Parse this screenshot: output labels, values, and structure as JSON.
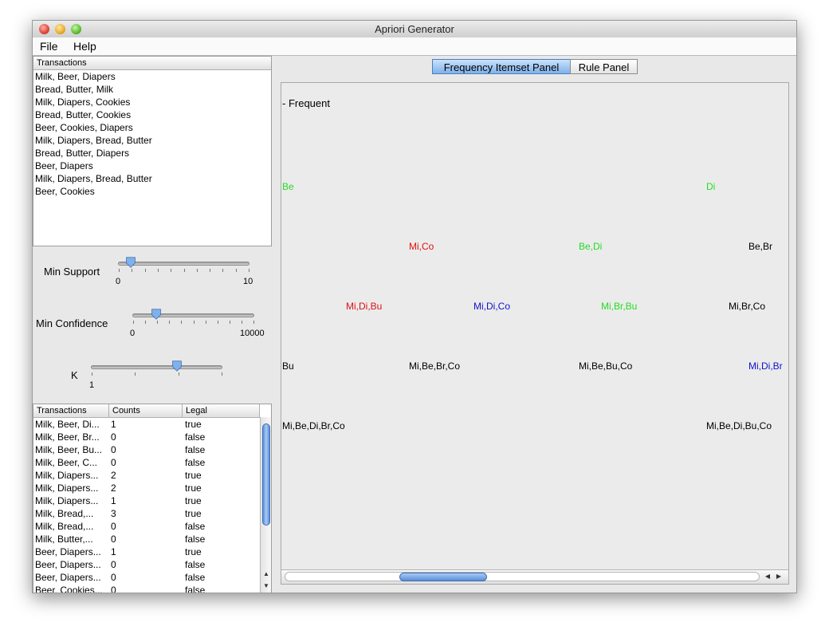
{
  "window": {
    "title": "Apriori Generator"
  },
  "menu": [
    {
      "label": "File"
    },
    {
      "label": "Help"
    }
  ],
  "transactions_list": {
    "header": "Transactions",
    "items": [
      "Milk, Beer, Diapers",
      "Bread, Butter, Milk",
      "Milk, Diapers, Cookies",
      "Bread, Butter, Cookies",
      "Beer, Cookies, Diapers",
      "Milk, Diapers, Bread, Butter",
      "Bread, Butter, Diapers",
      "Beer, Diapers",
      "Milk, Diapers, Bread, Butter",
      "Beer, Cookies"
    ]
  },
  "sliders": {
    "min_support": {
      "label": "Min Support",
      "min_label": "0",
      "max_label": "10",
      "value": 1
    },
    "min_confidence": {
      "label": "Min Confidence",
      "min_label": "0",
      "max_label": "10000",
      "value": 2000
    },
    "k": {
      "label": "K",
      "min_label": "1",
      "value_fraction": 0.66
    }
  },
  "results_table": {
    "columns": [
      "Transactions",
      "Counts",
      "Legal"
    ],
    "rows": [
      [
        "Milk, Beer, Di...",
        "1",
        "true"
      ],
      [
        "Milk, Beer, Br...",
        "0",
        "false"
      ],
      [
        "Milk, Beer, Bu...",
        "0",
        "false"
      ],
      [
        "Milk, Beer, C...",
        "0",
        "false"
      ],
      [
        "Milk, Diapers...",
        "2",
        "true"
      ],
      [
        "Milk, Diapers...",
        "2",
        "true"
      ],
      [
        "Milk, Diapers...",
        "1",
        "true"
      ],
      [
        "Milk, Bread,...",
        "3",
        "true"
      ],
      [
        "Milk, Bread,...",
        "0",
        "false"
      ],
      [
        "Milk, Butter,...",
        "0",
        "false"
      ],
      [
        "Beer, Diapers...",
        "1",
        "true"
      ],
      [
        "Beer, Diapers...",
        "0",
        "false"
      ],
      [
        "Beer, Diapers...",
        "0",
        "false"
      ],
      [
        "Beer, Cookies...",
        "0",
        "false"
      ]
    ]
  },
  "tabs": [
    {
      "label": "Frequency Itemset Panel",
      "active": true
    },
    {
      "label": "Rule Panel",
      "active": false
    }
  ],
  "itemset_panel": {
    "legend": "- Frequent",
    "colors": {
      "green": "#22dd22",
      "red": "#dd1111",
      "blue": "#1111cc",
      "black": "#000000"
    },
    "levels": [
      [
        {
          "text": "Be",
          "color": "green"
        },
        {
          "text": "Di",
          "color": "green"
        }
      ],
      [
        {
          "text": "Mi,Co",
          "color": "red"
        },
        {
          "text": "Be,Di",
          "color": "green"
        },
        {
          "text": "Be,Br",
          "color": "black"
        }
      ],
      [
        {
          "text": "Mi,Di,Bu",
          "color": "red"
        },
        {
          "text": "Mi,Di,Co",
          "color": "blue"
        },
        {
          "text": "Mi,Br,Bu",
          "color": "green"
        },
        {
          "text": "Mi,Br,Co",
          "color": "black"
        }
      ],
      [
        {
          "text": "Bu",
          "color": "black"
        },
        {
          "text": "Mi,Be,Br,Co",
          "color": "black"
        },
        {
          "text": "Mi,Be,Bu,Co",
          "color": "black"
        },
        {
          "text": "Mi,Di,Br",
          "color": "blue"
        }
      ],
      [
        {
          "text": "Mi,Be,Di,Br,Co",
          "color": "black"
        },
        {
          "text": "Mi,Be,Di,Bu,Co",
          "color": "black"
        }
      ]
    ]
  }
}
